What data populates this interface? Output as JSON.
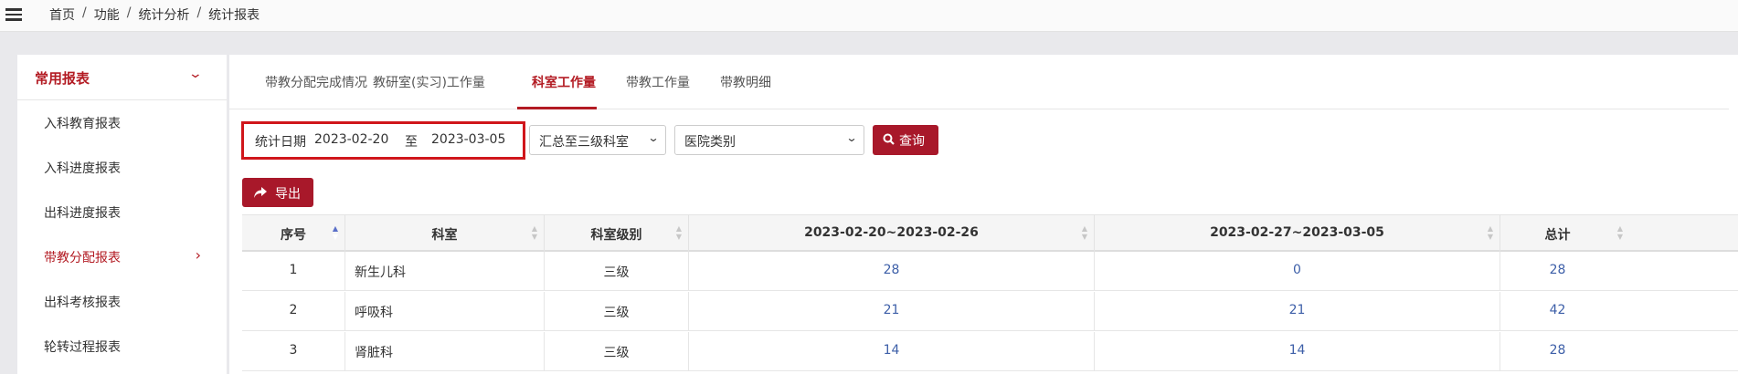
{
  "breadcrumb": [
    "首页",
    "功能",
    "统计分析",
    "统计报表"
  ],
  "breadcrumb_separator": "/",
  "sidebar": {
    "header": "常用报表",
    "items": [
      {
        "label": "入科教育报表",
        "active": false
      },
      {
        "label": "入科进度报表",
        "active": false
      },
      {
        "label": "出科进度报表",
        "active": false
      },
      {
        "label": "带教分配报表",
        "active": true
      },
      {
        "label": "出科考核报表",
        "active": false
      },
      {
        "label": "轮转过程报表",
        "active": false
      }
    ]
  },
  "tabs": [
    {
      "label": "带教分配完成情况",
      "active": false
    },
    {
      "label": "教研室(实习)工作量",
      "active": false
    },
    {
      "label": "科室工作量",
      "active": true
    },
    {
      "label": "带教工作量",
      "active": false
    },
    {
      "label": "带教明细",
      "active": false
    }
  ],
  "filter": {
    "label": "统计日期",
    "start_date": "2023-02-20",
    "separator": "至",
    "end_date": "2023-03-05",
    "level_select": "汇总至三级科室",
    "hospital_select": "医院类别",
    "query_button": "查询",
    "export_button": "导出"
  },
  "table": {
    "columns": [
      "序号",
      "科室",
      "科室级别",
      "2023-02-20~2023-02-26",
      "2023-02-27~2023-03-05",
      "总计"
    ],
    "rows": [
      [
        "1",
        "新生儿科",
        "三级",
        "28",
        "0",
        "28"
      ],
      [
        "2",
        "呼吸科",
        "三级",
        "21",
        "21",
        "42"
      ],
      [
        "3",
        "肾脏科",
        "三级",
        "14",
        "14",
        "28"
      ]
    ]
  },
  "colors": {
    "accent": "#b31b23",
    "button": "#a8182a",
    "highlight_border": "#d0161b",
    "link": "#3d5fa8"
  }
}
